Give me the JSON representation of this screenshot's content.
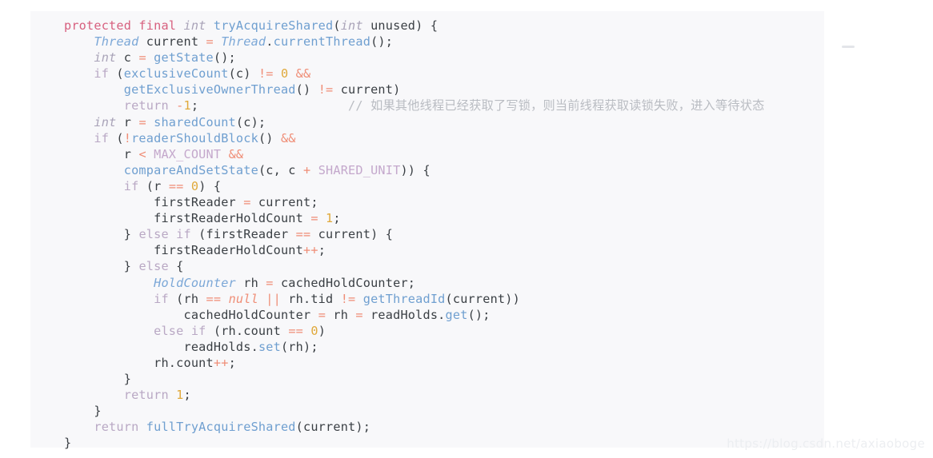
{
  "watermark": {
    "text": "https://blog.csdn.net/axiaoboge"
  },
  "card": {
    "background_color": "#f8f8fa",
    "page_background_color": "#ffffff"
  },
  "palette": {
    "keyword": "#d7607f",
    "type": "#a9a3b8",
    "class": "#7ba7d7",
    "function": "#6f9fd0",
    "plain": "#3a3f44",
    "operator": "#ef8d76",
    "number": "#e0a93b",
    "control": "#b9a8c4",
    "constant": "#c4a8cc",
    "null_literal": "#ef8d76",
    "comment": "#b9bcc2"
  },
  "code": {
    "language": "java",
    "method_name": "tryAcquireShared",
    "plain_text": "protected final int tryAcquireShared(int unused) {\n    Thread current = Thread.currentThread();\n    int c = getState();\n    if (exclusiveCount(c) != 0 &&\n        getExclusiveOwnerThread() != current)\n        return -1;                    // 如果其他线程已经获取了写锁，则当前线程获取读锁失败，进入等待状态\n    int r = sharedCount(c);\n    if (!readerShouldBlock() &&\n        r < MAX_COUNT &&\n        compareAndSetState(c, c + SHARED_UNIT)) {\n        if (r == 0) {\n            firstReader = current;\n            firstReaderHoldCount = 1;\n        } else if (firstReader == current) {\n            firstReaderHoldCount++;\n        } else {\n            HoldCounter rh = cachedHoldCounter;\n            if (rh == null || rh.tid != getThreadId(current))\n                cachedHoldCounter = rh = readHolds.get();\n            else if (rh.count == 0)\n                readHolds.set(rh);\n            rh.count++;\n        }\n        return 1;\n    }\n    return fullTryAcquireShared(current);\n}",
    "lines": [
      {
        "n": 1,
        "tokens": [
          {
            "c": "kw",
            "t": "protected final "
          },
          {
            "c": "type",
            "t": "int"
          },
          {
            "c": "plain",
            "t": " "
          },
          {
            "c": "fn",
            "t": "tryAcquireShared"
          },
          {
            "c": "plain",
            "t": "("
          },
          {
            "c": "type",
            "t": "int"
          },
          {
            "c": "plain",
            "t": " unused) {"
          }
        ]
      },
      {
        "n": 2,
        "tokens": [
          {
            "c": "plain",
            "t": "    "
          },
          {
            "c": "cls",
            "t": "Thread"
          },
          {
            "c": "plain",
            "t": " current "
          },
          {
            "c": "op",
            "t": "="
          },
          {
            "c": "plain",
            "t": " "
          },
          {
            "c": "cls",
            "t": "Thread"
          },
          {
            "c": "plain",
            "t": "."
          },
          {
            "c": "fn",
            "t": "currentThread"
          },
          {
            "c": "plain",
            "t": "();"
          }
        ]
      },
      {
        "n": 3,
        "tokens": [
          {
            "c": "plain",
            "t": "    "
          },
          {
            "c": "type",
            "t": "int"
          },
          {
            "c": "plain",
            "t": " c "
          },
          {
            "c": "op",
            "t": "="
          },
          {
            "c": "plain",
            "t": " "
          },
          {
            "c": "fn",
            "t": "getState"
          },
          {
            "c": "plain",
            "t": "();"
          }
        ]
      },
      {
        "n": 4,
        "tokens": [
          {
            "c": "plain",
            "t": "    "
          },
          {
            "c": "ctl",
            "t": "if"
          },
          {
            "c": "plain",
            "t": " ("
          },
          {
            "c": "fn",
            "t": "exclusiveCount"
          },
          {
            "c": "plain",
            "t": "(c) "
          },
          {
            "c": "op",
            "t": "!="
          },
          {
            "c": "plain",
            "t": " "
          },
          {
            "c": "num",
            "t": "0"
          },
          {
            "c": "plain",
            "t": " "
          },
          {
            "c": "op",
            "t": "&&"
          }
        ]
      },
      {
        "n": 5,
        "tokens": [
          {
            "c": "plain",
            "t": "        "
          },
          {
            "c": "fn",
            "t": "getExclusiveOwnerThread"
          },
          {
            "c": "plain",
            "t": "() "
          },
          {
            "c": "op",
            "t": "!="
          },
          {
            "c": "plain",
            "t": " current)"
          }
        ]
      },
      {
        "n": 6,
        "tokens": [
          {
            "c": "plain",
            "t": "        "
          },
          {
            "c": "ctl",
            "t": "return"
          },
          {
            "c": "plain",
            "t": " "
          },
          {
            "c": "op",
            "t": "-"
          },
          {
            "c": "num",
            "t": "1"
          },
          {
            "c": "plain",
            "t": ";"
          },
          {
            "c": "cmt",
            "t": "                    // "
          },
          {
            "c": "cmt cjk",
            "t": "如果其他线程已经获取了写锁，则当前线程获取读锁失败，进入等待状态"
          }
        ]
      },
      {
        "n": 7,
        "tokens": [
          {
            "c": "plain",
            "t": "    "
          },
          {
            "c": "type",
            "t": "int"
          },
          {
            "c": "plain",
            "t": " r "
          },
          {
            "c": "op",
            "t": "="
          },
          {
            "c": "plain",
            "t": " "
          },
          {
            "c": "fn",
            "t": "sharedCount"
          },
          {
            "c": "plain",
            "t": "(c);"
          }
        ]
      },
      {
        "n": 8,
        "tokens": [
          {
            "c": "plain",
            "t": "    "
          },
          {
            "c": "ctl",
            "t": "if"
          },
          {
            "c": "plain",
            "t": " ("
          },
          {
            "c": "op",
            "t": "!"
          },
          {
            "c": "fn",
            "t": "readerShouldBlock"
          },
          {
            "c": "plain",
            "t": "() "
          },
          {
            "c": "op",
            "t": "&&"
          }
        ]
      },
      {
        "n": 9,
        "tokens": [
          {
            "c": "plain",
            "t": "        r "
          },
          {
            "c": "op",
            "t": "<"
          },
          {
            "c": "plain",
            "t": " "
          },
          {
            "c": "const",
            "t": "MAX_COUNT"
          },
          {
            "c": "plain",
            "t": " "
          },
          {
            "c": "op",
            "t": "&&"
          }
        ]
      },
      {
        "n": 10,
        "tokens": [
          {
            "c": "plain",
            "t": "        "
          },
          {
            "c": "fn",
            "t": "compareAndSetState"
          },
          {
            "c": "plain",
            "t": "(c, c "
          },
          {
            "c": "op",
            "t": "+"
          },
          {
            "c": "plain",
            "t": " "
          },
          {
            "c": "const",
            "t": "SHARED_UNIT"
          },
          {
            "c": "plain",
            "t": ")) {"
          }
        ]
      },
      {
        "n": 11,
        "tokens": [
          {
            "c": "plain",
            "t": "        "
          },
          {
            "c": "ctl",
            "t": "if"
          },
          {
            "c": "plain",
            "t": " (r "
          },
          {
            "c": "op",
            "t": "=="
          },
          {
            "c": "plain",
            "t": " "
          },
          {
            "c": "num",
            "t": "0"
          },
          {
            "c": "plain",
            "t": ") {"
          }
        ]
      },
      {
        "n": 12,
        "tokens": [
          {
            "c": "plain",
            "t": "            firstReader "
          },
          {
            "c": "op",
            "t": "="
          },
          {
            "c": "plain",
            "t": " current;"
          }
        ]
      },
      {
        "n": 13,
        "tokens": [
          {
            "c": "plain",
            "t": "            firstReaderHoldCount "
          },
          {
            "c": "op",
            "t": "="
          },
          {
            "c": "plain",
            "t": " "
          },
          {
            "c": "num",
            "t": "1"
          },
          {
            "c": "plain",
            "t": ";"
          }
        ]
      },
      {
        "n": 14,
        "tokens": [
          {
            "c": "plain",
            "t": "        } "
          },
          {
            "c": "ctl",
            "t": "else if"
          },
          {
            "c": "plain",
            "t": " (firstReader "
          },
          {
            "c": "op",
            "t": "=="
          },
          {
            "c": "plain",
            "t": " current) {"
          }
        ]
      },
      {
        "n": 15,
        "tokens": [
          {
            "c": "plain",
            "t": "            firstReaderHoldCount"
          },
          {
            "c": "op",
            "t": "++"
          },
          {
            "c": "plain",
            "t": ";"
          }
        ]
      },
      {
        "n": 16,
        "tokens": [
          {
            "c": "plain",
            "t": "        } "
          },
          {
            "c": "ctl",
            "t": "else"
          },
          {
            "c": "plain",
            "t": " {"
          }
        ]
      },
      {
        "n": 17,
        "tokens": [
          {
            "c": "plain",
            "t": "            "
          },
          {
            "c": "cls",
            "t": "HoldCounter"
          },
          {
            "c": "plain",
            "t": " rh "
          },
          {
            "c": "op",
            "t": "="
          },
          {
            "c": "plain",
            "t": " cachedHoldCounter;"
          }
        ]
      },
      {
        "n": 18,
        "tokens": [
          {
            "c": "plain",
            "t": "            "
          },
          {
            "c": "ctl",
            "t": "if"
          },
          {
            "c": "plain",
            "t": " (rh "
          },
          {
            "c": "op",
            "t": "=="
          },
          {
            "c": "plain",
            "t": " "
          },
          {
            "c": "null",
            "t": "null"
          },
          {
            "c": "plain",
            "t": " "
          },
          {
            "c": "op",
            "t": "||"
          },
          {
            "c": "plain",
            "t": " rh.tid "
          },
          {
            "c": "op",
            "t": "!="
          },
          {
            "c": "plain",
            "t": " "
          },
          {
            "c": "fn",
            "t": "getThreadId"
          },
          {
            "c": "plain",
            "t": "(current))"
          }
        ]
      },
      {
        "n": 19,
        "tokens": [
          {
            "c": "plain",
            "t": "                cachedHoldCounter "
          },
          {
            "c": "op",
            "t": "="
          },
          {
            "c": "plain",
            "t": " rh "
          },
          {
            "c": "op",
            "t": "="
          },
          {
            "c": "plain",
            "t": " readHolds."
          },
          {
            "c": "fn",
            "t": "get"
          },
          {
            "c": "plain",
            "t": "();"
          }
        ]
      },
      {
        "n": 20,
        "tokens": [
          {
            "c": "plain",
            "t": "            "
          },
          {
            "c": "ctl",
            "t": "else if"
          },
          {
            "c": "plain",
            "t": " (rh.count "
          },
          {
            "c": "op",
            "t": "=="
          },
          {
            "c": "plain",
            "t": " "
          },
          {
            "c": "num",
            "t": "0"
          },
          {
            "c": "plain",
            "t": ")"
          }
        ]
      },
      {
        "n": 21,
        "tokens": [
          {
            "c": "plain",
            "t": "                readHolds."
          },
          {
            "c": "fn",
            "t": "set"
          },
          {
            "c": "plain",
            "t": "(rh);"
          }
        ]
      },
      {
        "n": 22,
        "tokens": [
          {
            "c": "plain",
            "t": "            rh.count"
          },
          {
            "c": "op",
            "t": "++"
          },
          {
            "c": "plain",
            "t": ";"
          }
        ]
      },
      {
        "n": 23,
        "tokens": [
          {
            "c": "plain",
            "t": "        }"
          }
        ]
      },
      {
        "n": 24,
        "tokens": [
          {
            "c": "plain",
            "t": "        "
          },
          {
            "c": "ctl",
            "t": "return"
          },
          {
            "c": "plain",
            "t": " "
          },
          {
            "c": "num",
            "t": "1"
          },
          {
            "c": "plain",
            "t": ";"
          }
        ]
      },
      {
        "n": 25,
        "tokens": [
          {
            "c": "plain",
            "t": "    }"
          }
        ]
      },
      {
        "n": 26,
        "tokens": [
          {
            "c": "plain",
            "t": "    "
          },
          {
            "c": "ctl",
            "t": "return"
          },
          {
            "c": "plain",
            "t": " "
          },
          {
            "c": "fn",
            "t": "fullTryAcquireShared"
          },
          {
            "c": "plain",
            "t": "(current);"
          }
        ]
      },
      {
        "n": 27,
        "tokens": [
          {
            "c": "plain",
            "t": "}"
          }
        ]
      }
    ]
  }
}
